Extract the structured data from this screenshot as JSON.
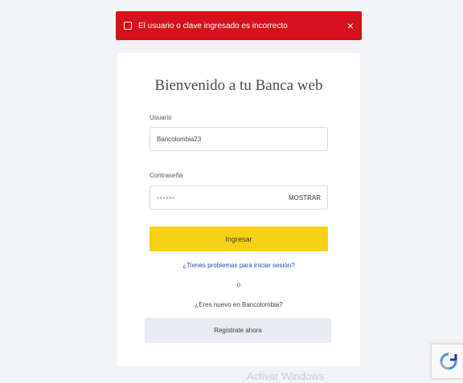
{
  "alert": {
    "message": "El usuario o clave ingresado es incorrecto",
    "close_glyph": "×"
  },
  "login": {
    "title": "Bienvenido a tu Banca web",
    "user_label": "Usuario",
    "user_value": "Bancolombia23",
    "password_label": "Contraseña",
    "password_value": "••••••",
    "show_label": "MOSTRAR",
    "submit_label": "Ingresar",
    "forgot_link": "¿Tienes problemas para iniciar sesión?",
    "or_label": "o",
    "question": "¿Eres nuevo en Bancolombia?",
    "register_label": "Regístrate ahora"
  },
  "footer": {
    "watermark": "Activar Windows"
  },
  "colors": {
    "alert": "#d4111c",
    "primary_button": "#f7d116",
    "link": "#1f4fa8"
  }
}
